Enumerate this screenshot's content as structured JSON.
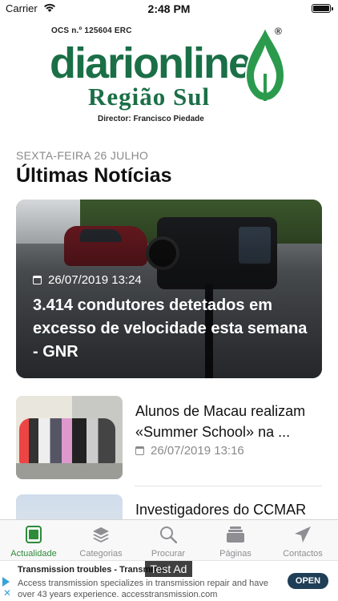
{
  "status_bar": {
    "carrier": "Carrier",
    "time": "2:48 PM"
  },
  "logo": {
    "ocs": "OCS n.º 125604 ERC",
    "brand": "diarionline",
    "registered": "®",
    "region": "Região Sul",
    "director": "Director: Francisco Piedade",
    "brand_color": "#1b6f47"
  },
  "feed": {
    "date_label": "SEXTA-FEIRA 26 JULHO",
    "title": "Últimas Notícias"
  },
  "hero": {
    "timestamp": "26/07/2019 13:24",
    "headline": "3.414 condutores detetados em excesso de velocidade esta semana - GNR",
    "icon": "calendar-icon"
  },
  "articles": [
    {
      "headline": "Alunos de Macau realizam «Summer School» na ...",
      "timestamp": "26/07/2019 13:16",
      "icon": "calendar-icon"
    },
    {
      "headline": "Investigadores do CCMAR",
      "timestamp": ""
    }
  ],
  "tabs": [
    {
      "label": "Actualidade",
      "icon": "news-icon",
      "active": true
    },
    {
      "label": "Categorias",
      "icon": "layers-icon",
      "active": false
    },
    {
      "label": "Procurar",
      "icon": "search-icon",
      "active": false
    },
    {
      "label": "Páginas",
      "icon": "pages-icon",
      "active": false
    },
    {
      "label": "Contactos",
      "icon": "send-icon",
      "active": false
    }
  ],
  "accent_color": "#2e8b3a",
  "ad": {
    "title": "Transmission troubles - Transmissi",
    "body": "Access transmission specializes in transmission repair and have over 43 years experience. accesstransmission.com",
    "cta": "OPEN",
    "test_badge": "Test Ad"
  }
}
